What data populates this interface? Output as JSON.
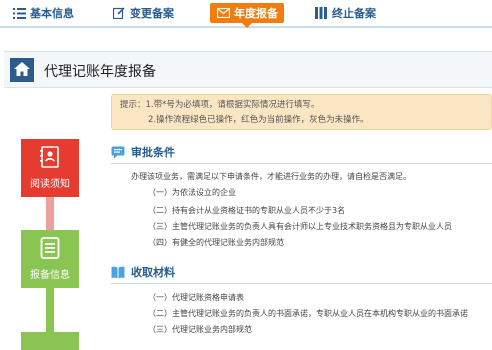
{
  "tabs": [
    {
      "label": "基本信息",
      "icon": "list-icon",
      "active": false
    },
    {
      "label": "变更备案",
      "icon": "edit-icon",
      "active": false
    },
    {
      "label": "年度报备",
      "icon": "mail-icon",
      "active": true
    },
    {
      "label": "终止备案",
      "icon": "columns-icon",
      "active": false
    }
  ],
  "page": {
    "title": "代理记账年度报备",
    "icon": "home-icon"
  },
  "tip": {
    "line1": "提示：1.带*号为必填项，请根据实际情况进行填写。",
    "line2": "2.操作流程绿色已操作，红色为当前操作，灰色为未操作。"
  },
  "steps": [
    {
      "label": "阅读须知",
      "icon": "notebook-icon",
      "status": "current"
    },
    {
      "label": "报备信息",
      "icon": "document-icon",
      "status": "done"
    }
  ],
  "approval": {
    "title": "审批条件",
    "icon": "chat-icon",
    "intro": "办理该项业务，需满足以下申请条件，才能进行业务的办理，请自检是否满足。",
    "items": [
      "（一）为依法设立的企业",
      "（二）持有会计从业资格证书的专职从业人员不少于3名",
      "（三）主管代理记账业务的负责人具有会计师以上专业技术职务资格且为专职从业人员",
      "（四）有健全的代理记账业务内部规范"
    ]
  },
  "materials": {
    "title": "收取材料",
    "icon": "book-icon",
    "items": [
      "（一）代理记账资格申请表",
      "（二）主管代理记账业务的负责人的书面承诺，专职从业人员在本机构专职从业的书面承诺",
      "（三）代理记账业务内部规范"
    ]
  },
  "colors": {
    "accent": "#f07d12",
    "blue": "#2a5d8f",
    "current": "#e63b2f",
    "done": "#8ac553",
    "tip_bg": "#fbe6c4"
  }
}
